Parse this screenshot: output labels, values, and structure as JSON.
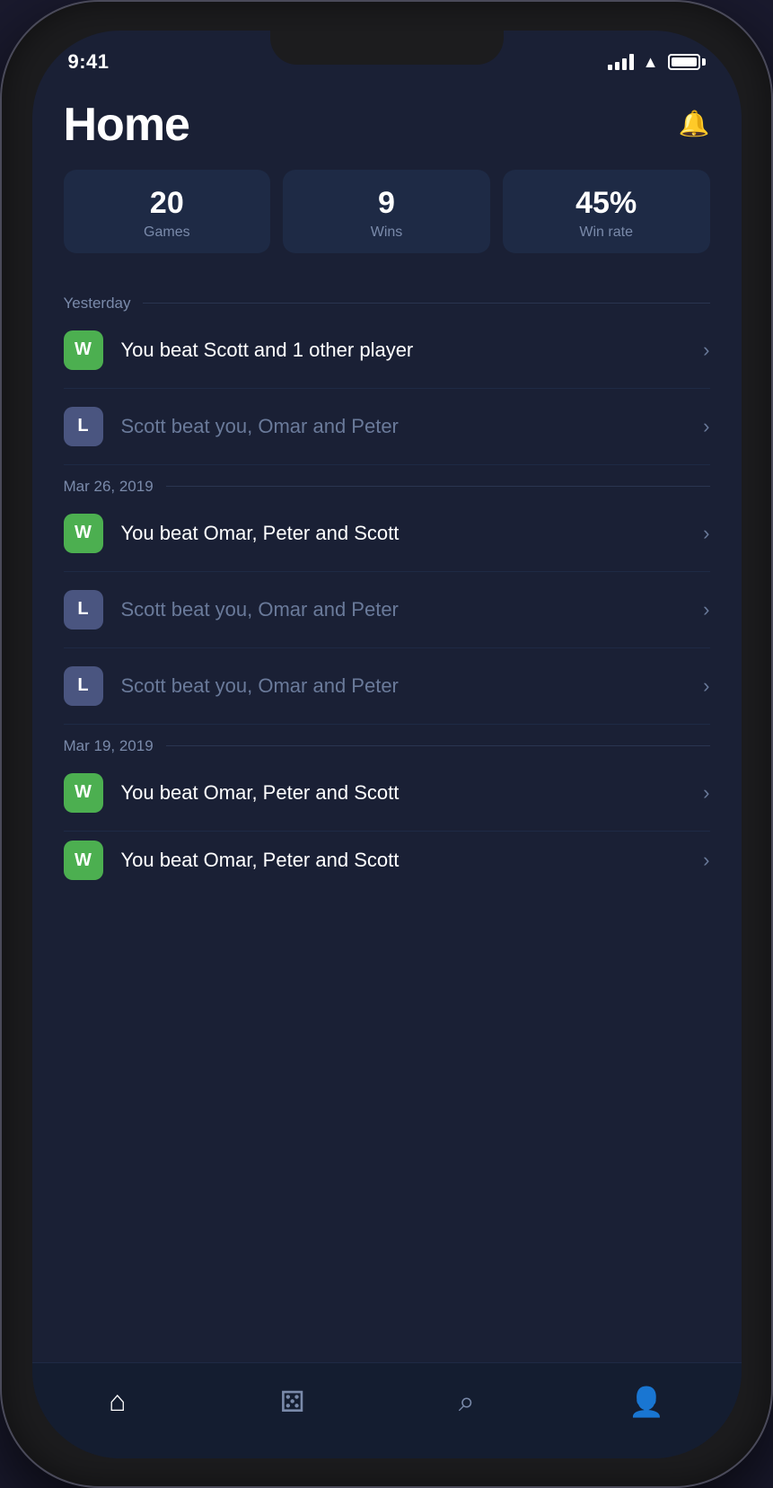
{
  "status": {
    "time": "9:41"
  },
  "header": {
    "title": "Home",
    "notification_icon": "🔔"
  },
  "stats": [
    {
      "value": "20",
      "label": "Games"
    },
    {
      "value": "9",
      "label": "Wins"
    },
    {
      "value": "45%",
      "label": "Win rate"
    }
  ],
  "sections": [
    {
      "label": "Yesterday",
      "games": [
        {
          "type": "win",
          "badge": "W",
          "text": "You beat Scott and 1 other player"
        },
        {
          "type": "loss",
          "badge": "L",
          "text": "Scott beat you, Omar and Peter"
        }
      ]
    },
    {
      "label": "Mar 26, 2019",
      "games": [
        {
          "type": "win",
          "badge": "W",
          "text": "You beat Omar, Peter and Scott"
        },
        {
          "type": "loss",
          "badge": "L",
          "text": "Scott beat you, Omar and Peter"
        },
        {
          "type": "loss",
          "badge": "L",
          "text": "Scott beat you, Omar and Peter"
        }
      ]
    },
    {
      "label": "Mar 19, 2019",
      "games": [
        {
          "type": "win",
          "badge": "W",
          "text": "You beat Omar, Peter and Scott"
        },
        {
          "type": "win",
          "badge": "W",
          "text": "You beat Omar, Peter and Scott"
        }
      ]
    }
  ],
  "nav": [
    {
      "icon": "🏠",
      "label": "Home",
      "active": true
    },
    {
      "icon": "🎲",
      "label": "Games",
      "active": false
    },
    {
      "icon": "🔍",
      "label": "Search",
      "active": false
    },
    {
      "icon": "👤",
      "label": "Profile",
      "active": false
    }
  ]
}
